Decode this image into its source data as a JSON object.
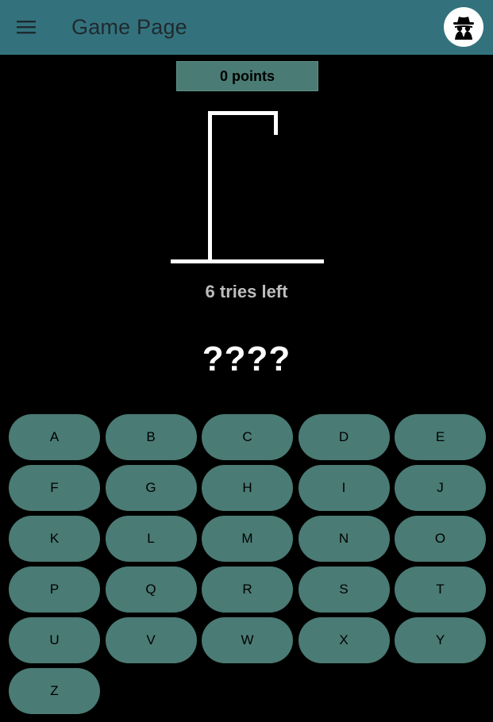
{
  "appbar": {
    "title": "Game Page",
    "menu_icon": "hamburger-menu-icon",
    "avatar_icon": "incognito-spy-icon",
    "background_color": "#33727d"
  },
  "score": {
    "label": "0 points"
  },
  "hangman": {
    "tries_label": "6 tries left",
    "word": "????"
  },
  "keyboard": {
    "key_color": "#4a7b74",
    "letters": [
      "A",
      "B",
      "C",
      "D",
      "E",
      "F",
      "G",
      "H",
      "I",
      "J",
      "K",
      "L",
      "M",
      "N",
      "O",
      "P",
      "Q",
      "R",
      "S",
      "T",
      "U",
      "V",
      "W",
      "X",
      "Y",
      "Z"
    ]
  }
}
